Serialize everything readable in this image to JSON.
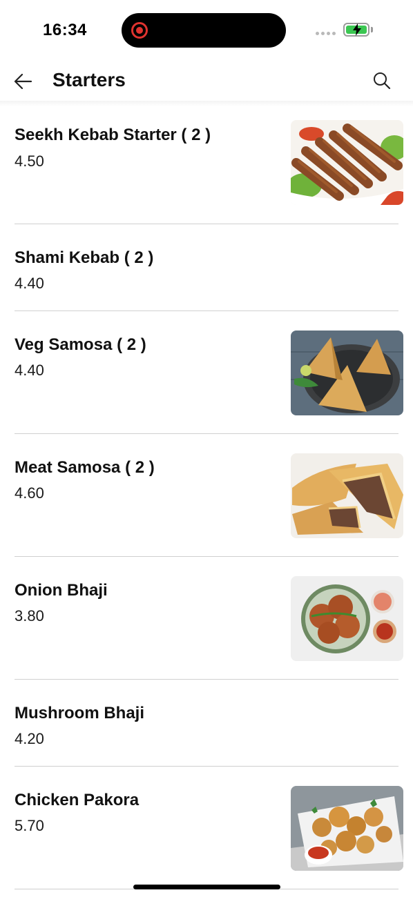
{
  "status_bar": {
    "time": "16:34",
    "recording_icon": "screen-record-icon",
    "signal_icon": "cellular-signal-icon",
    "battery_icon": "battery-charging-icon",
    "battery_color": "#3bc752"
  },
  "header": {
    "back_icon": "back-arrow-icon",
    "title": "Starters",
    "search_icon": "search-icon"
  },
  "items": [
    {
      "name": "Seekh Kebab Starter ( 2 )",
      "price": "4.50",
      "has_image": true,
      "image_subject": "seekh kebab"
    },
    {
      "name": "Shami Kebab ( 2 )",
      "price": "4.40",
      "has_image": false
    },
    {
      "name": "Veg Samosa ( 2 )",
      "price": "4.40",
      "has_image": true,
      "image_subject": "veg samosa"
    },
    {
      "name": "Meat Samosa ( 2 )",
      "price": "4.60",
      "has_image": true,
      "image_subject": "meat samosa"
    },
    {
      "name": "Onion Bhaji",
      "price": "3.80",
      "has_image": true,
      "image_subject": "onion bhaji"
    },
    {
      "name": "Mushroom Bhaji",
      "price": "4.20",
      "has_image": false
    },
    {
      "name": "Chicken Pakora",
      "price": "5.70",
      "has_image": true,
      "image_subject": "chicken pakora"
    }
  ]
}
